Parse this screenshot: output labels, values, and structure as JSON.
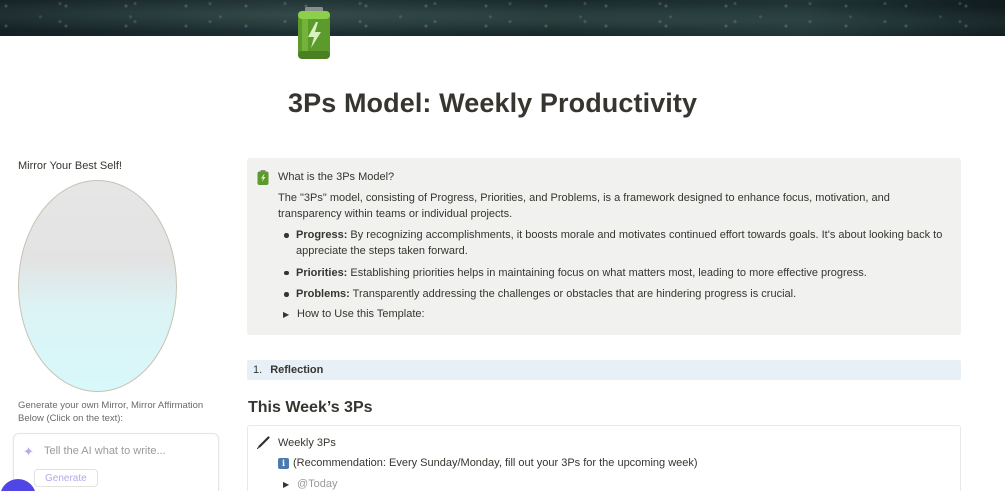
{
  "page": {
    "title": "3Ps Model: Weekly Productivity",
    "icon": "battery-icon"
  },
  "sidebar": {
    "mirror_label": "Mirror Your Best Self!",
    "mirror_instructions": "Generate your own Mirror, Mirror Affirmation Below (Click on the text):",
    "ai_placeholder": "Tell the AI what to write...",
    "generate_label": "Generate"
  },
  "callout": {
    "title": "What is the 3Ps Model?",
    "description": "The \"3Ps\" model, consisting of Progress, Priorities, and Problems, is a framework designed to enhance focus, motivation, and transparency within teams or individual projects.",
    "items": [
      {
        "term": "Progress:",
        "text": " By recognizing accomplishments, it boosts morale and motivates continued effort towards goals. It's about looking back to appreciate the steps taken forward."
      },
      {
        "term": "Priorities:",
        "text": " Establishing priorities helps in maintaining focus on what matters most, leading to more effective progress."
      },
      {
        "term": "Problems:",
        "text": " Transparently addressing the challenges or obstacles that are hindering progress is crucial."
      }
    ],
    "toggle_label": "How to Use this Template:"
  },
  "reflection": {
    "number": "1.",
    "label": "Reflection"
  },
  "week": {
    "heading": "This Week’s 3Ps",
    "callout_title": "Weekly 3Ps",
    "info_icon_text": "i",
    "recommendation": "(Recommendation: Every Sunday/Monday, fill out your 3Ps for the upcoming week)",
    "today_label": "@Today"
  },
  "colors": {
    "callout_bg": "#f1f1ef",
    "reflection_bg": "#e7f0f7",
    "accent_purple": "#b7a6f0",
    "battery_green": "#6aa832",
    "help_button": "#4f46e5"
  }
}
